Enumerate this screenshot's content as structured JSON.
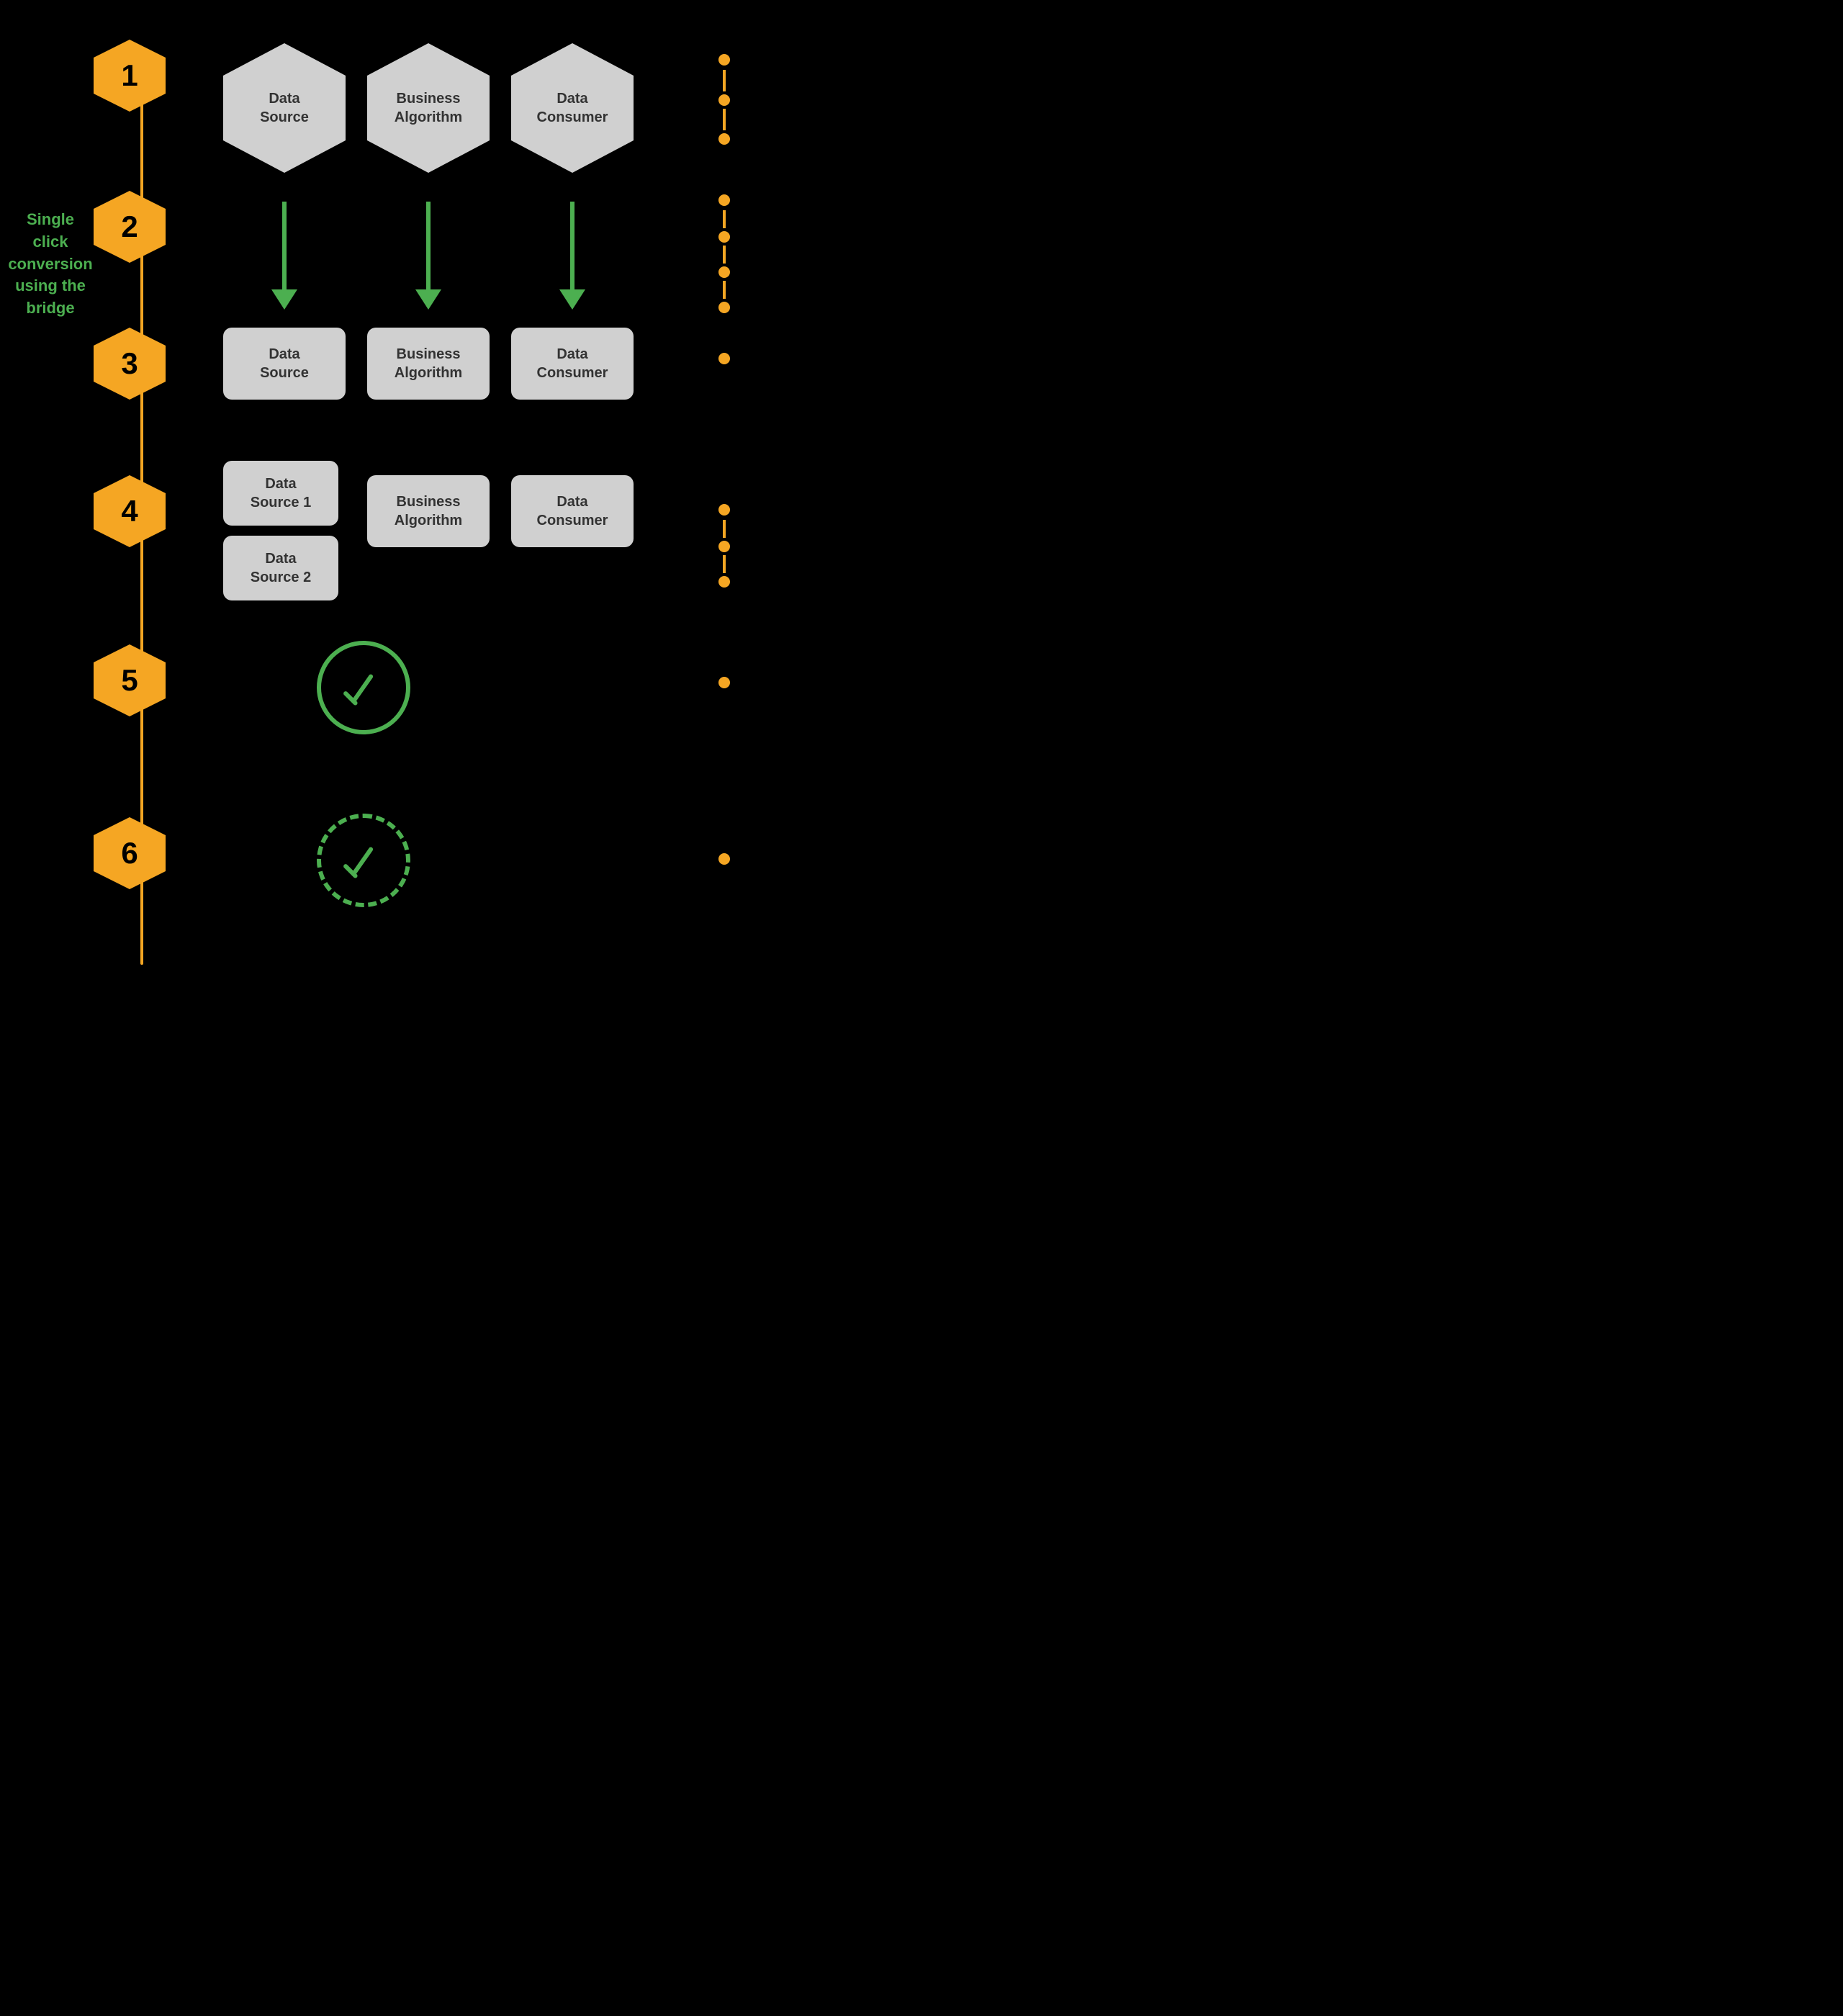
{
  "steps": [
    {
      "number": "1"
    },
    {
      "number": "2"
    },
    {
      "number": "3"
    },
    {
      "number": "4"
    },
    {
      "number": "5"
    },
    {
      "number": "6"
    }
  ],
  "side_label": {
    "line1": "Single click",
    "line2": "conversion",
    "line3": "using the bridge"
  },
  "row1": {
    "hex1": "Data\nSource",
    "hex2": "Business\nAlgorithm",
    "hex3": "Data\nConsumer"
  },
  "row3": {
    "box1": "Data\nSource",
    "box2": "Business\nAlgorithm",
    "box3": "Data\nConsumer"
  },
  "row4": {
    "src1": "Data\nSource 1",
    "src2": "Data\nSource 2",
    "algo": "Business\nAlgorithm",
    "consumer": "Data\nConsumer"
  }
}
